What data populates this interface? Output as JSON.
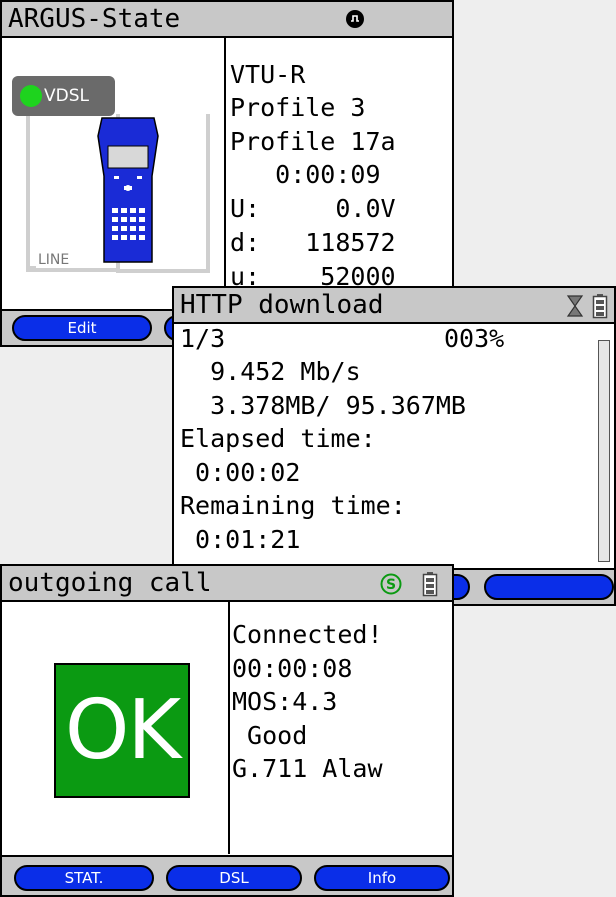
{
  "argus_state": {
    "title": "ARGUS-State",
    "status_icon": "record-icon",
    "dsl_label": "VDSL",
    "line_label": "LINE",
    "lines": [
      "VTU-R",
      "Profile 3",
      "Profile 17a",
      "   0:00:09",
      "U:     0.0V",
      "d:   118572",
      "u:    52000"
    ],
    "buttons": [
      "Edit",
      ""
    ]
  },
  "http_download": {
    "title": "HTTP download",
    "status_icon": "hourglass-icon",
    "battery_icon": "battery-icon",
    "counter": "1/3",
    "percent": "003%",
    "rate": "  9.452 Mb/s",
    "size": "  3.378MB/ 95.367MB",
    "elapsed_label": "Elapsed time:",
    "elapsed_value": " 0:00:02",
    "remaining_label": "Remaining time:",
    "remaining_value": " 0:01:21",
    "buttons": [
      "",
      ""
    ]
  },
  "outgoing_call": {
    "title": "outgoing call",
    "status_icon": "s-circle-icon",
    "battery_icon": "battery-icon",
    "ok_text": "OK",
    "lines": [
      "Connected!",
      "00:00:08",
      "MOS:4.3",
      " Good",
      "G.711 Alaw"
    ],
    "buttons": [
      "STAT.",
      "DSL",
      "Info"
    ]
  },
  "colors": {
    "button_blue": "#0a2ee8",
    "ok_green": "#0b9a12",
    "led_green": "#1ed31e",
    "title_gray": "#c8c8c8"
  }
}
